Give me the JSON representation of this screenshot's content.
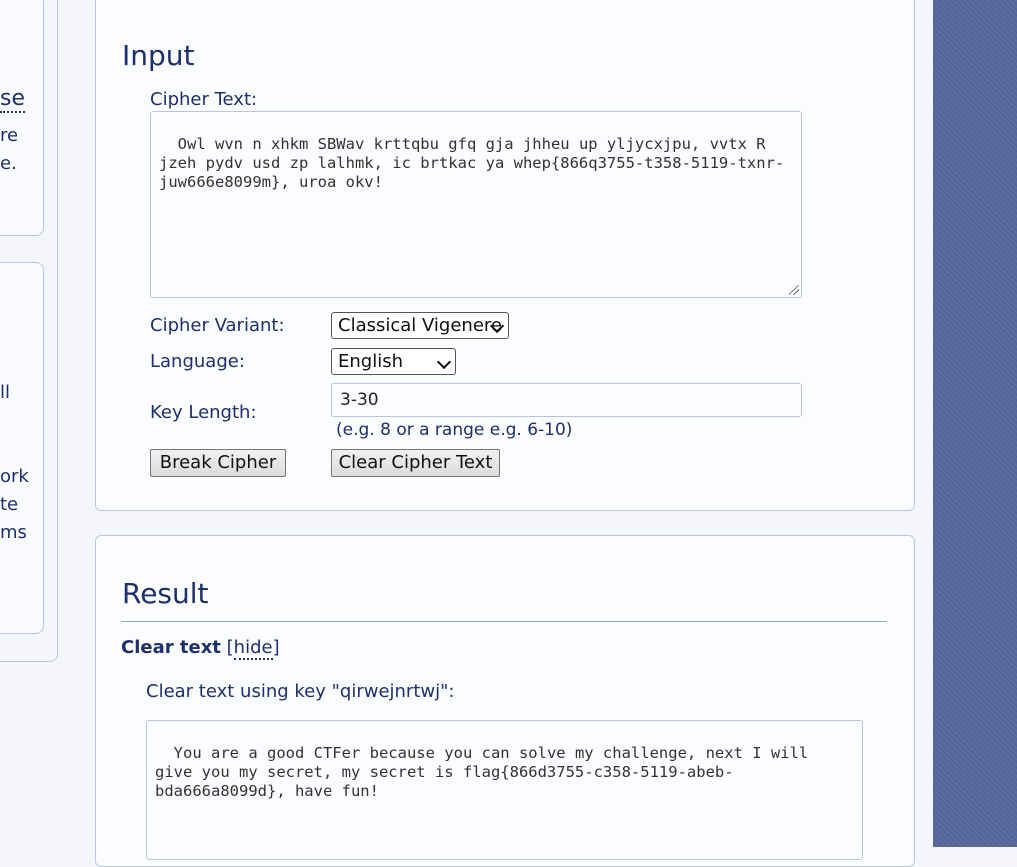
{
  "left_sidebar": {
    "fragments": [
      "se",
      "re",
      "e.",
      "ll",
      "ork",
      "te",
      "ms"
    ]
  },
  "input_panel": {
    "heading": "Input",
    "cipher_text_label": "Cipher Text:",
    "cipher_text_value": "Owl wvn n xhkm SBWav krttqbu gfq gja jhheu up yljycxjpu, vvtx R jzeh pydv usd zp lalhmk, ic brtkac ya whep{866q3755-t358-5119-txnr-juw666e8099m}, uroa okv!",
    "cipher_variant_label": "Cipher Variant:",
    "cipher_variant_value": "Classical Vigenere",
    "language_label": "Language:",
    "language_value": "English",
    "key_length_label": "Key Length:",
    "key_length_value": "3-30",
    "key_length_hint": "(e.g. 8 or a range e.g. 6-10)",
    "break_button": "Break Cipher",
    "clear_button": "Clear Cipher Text"
  },
  "result_panel": {
    "heading": "Result",
    "clear_text_heading": "Clear text",
    "hide_link_open": "[",
    "hide_link": "hide",
    "hide_link_close": "]",
    "clear_text_key_label": "Clear text using key \"qirwejnrtwj\":",
    "clear_text_value": "You are a good CTFer because you can solve my challenge, next I will give you my secret, my secret is flag{866d3755-c358-5119-abeb-bda666a8099d}, have fun!"
  },
  "colors": {
    "text": "#1e2f6e",
    "border": "#b9c5e0",
    "page_background": "#f4f6fb",
    "side_background": "#56679c"
  }
}
